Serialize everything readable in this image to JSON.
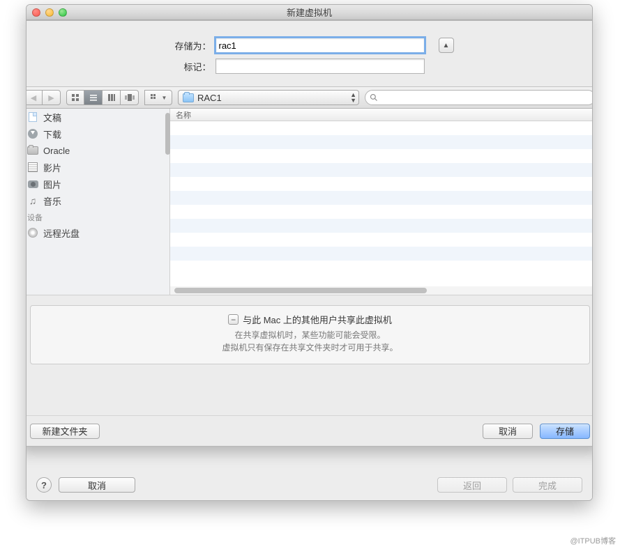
{
  "window": {
    "title": "新建虚拟机"
  },
  "form": {
    "save_as_label": "存储为：",
    "save_as_value": "rac1",
    "tag_label": "标记：",
    "tag_value": ""
  },
  "browser": {
    "path_name": "RAC1",
    "search_value": "",
    "search_placeholder": "",
    "back_disabled": true,
    "fwd_disabled": true,
    "list_header": "名称",
    "views": [
      "icon",
      "list",
      "column",
      "flow"
    ],
    "sidebar": [
      {
        "icon": "doc",
        "label": "文稿"
      },
      {
        "icon": "download",
        "label": "下载"
      },
      {
        "icon": "folder",
        "label": "Oracle"
      },
      {
        "icon": "film",
        "label": "影片"
      },
      {
        "icon": "camera",
        "label": "图片"
      },
      {
        "icon": "music",
        "label": "音乐"
      }
    ],
    "devices_header": "设备",
    "devices": [
      {
        "icon": "disc",
        "label": "远程光盘"
      }
    ]
  },
  "share": {
    "title": "与此 Mac 上的其他用户共享此虚拟机",
    "note1": "在共享虚拟机时，某些功能可能会受限。",
    "note2": "虚拟机只有保存在共享文件夹时才可用于共享。"
  },
  "buttons": {
    "new_folder": "新建文件夹",
    "cancel": "取消",
    "save": "存储",
    "parent_cancel": "取消",
    "parent_back": "返回",
    "parent_finish": "完成",
    "help": "?"
  },
  "watermark": "@ITPUB博客"
}
